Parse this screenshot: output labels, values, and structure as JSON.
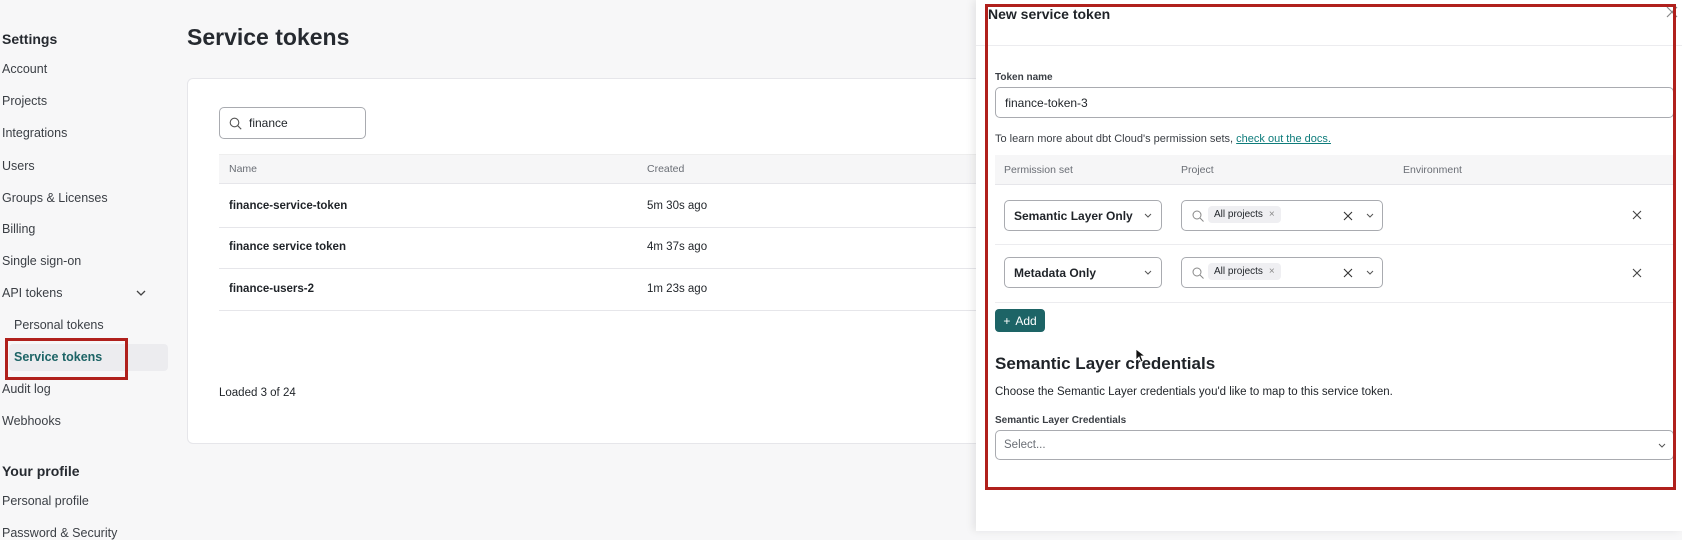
{
  "sidebar": {
    "settings_heading": "Settings",
    "items": [
      "Account",
      "Projects",
      "Integrations",
      "Users",
      "Groups & Licenses",
      "Billing",
      "Single sign-on",
      "API tokens"
    ],
    "sub_items": [
      "Personal tokens",
      "Service tokens"
    ],
    "more_items": [
      "Audit log",
      "Webhooks"
    ],
    "profile_heading": "Your profile",
    "profile_items": [
      "Personal profile",
      "Password & Security"
    ],
    "active": "Service tokens"
  },
  "main": {
    "title": "Service tokens",
    "search_value": "finance",
    "columns": [
      "Name",
      "Created"
    ],
    "rows": [
      {
        "name": "finance-service-token",
        "created": "5m 30s ago"
      },
      {
        "name": "finance service token",
        "created": "4m 37s ago"
      },
      {
        "name": "finance-users-2",
        "created": "1m 23s ago"
      }
    ],
    "footer": "Loaded 3 of 24"
  },
  "panel": {
    "title": "New service token",
    "token_name_label": "Token name",
    "token_name_value": "finance-token-3",
    "help_text": "To learn more about dbt Cloud's permission sets, ",
    "help_link": "check out the docs.",
    "perm_columns": [
      "Permission set",
      "Project",
      "Environment"
    ],
    "permissions": [
      {
        "set": "Semantic Layer Only",
        "project": "All projects"
      },
      {
        "set": "Metadata Only",
        "project": "All projects"
      }
    ],
    "add_label": "Add",
    "sl_heading": "Semantic Layer credentials",
    "sl_desc": "Choose the Semantic Layer credentials you'd like to map to this service token.",
    "sl_label": "Semantic Layer Credentials",
    "sl_placeholder": "Select..."
  },
  "colors": {
    "accent": "#1d6466",
    "link": "#0e7c7b",
    "highlight": "#b0201c"
  }
}
